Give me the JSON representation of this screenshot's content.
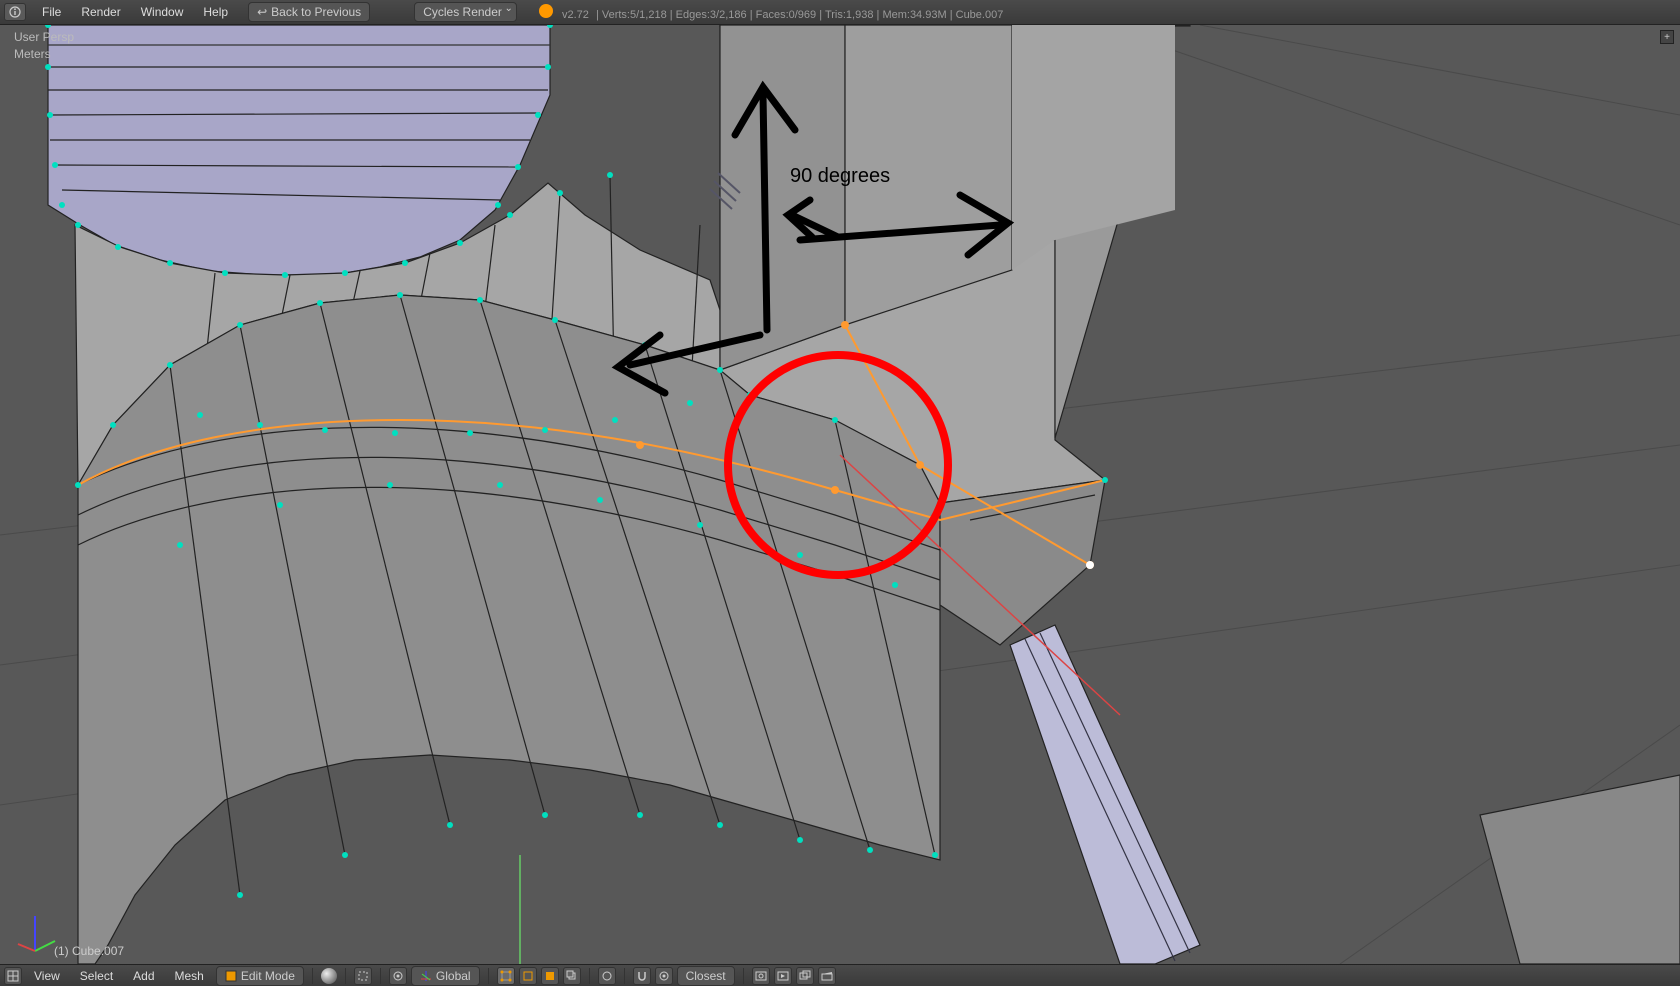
{
  "top_menu": {
    "file": "File",
    "render": "Render",
    "window": "Window",
    "help": "Help",
    "back": "Back to Previous",
    "engine": "Cycles Render"
  },
  "stats": {
    "version": "v2.72",
    "verts": "Verts:5/1,218",
    "edges": "Edges:3/2,186",
    "faces": "Faces:0/969",
    "tris": "Tris:1,938",
    "mem": "Mem:34.93M",
    "obj": "Cube.007"
  },
  "overlay": {
    "persp": "User Persp",
    "units": "Meters"
  },
  "viewport": {
    "obj_label": "(1) Cube.007"
  },
  "annotation": {
    "angle": "90 degrees"
  },
  "bottom_menu": {
    "view": "View",
    "select": "Select",
    "add": "Add",
    "mesh": "Mesh",
    "mode": "Edit Mode",
    "orientation": "Global",
    "snap": "Closest"
  }
}
